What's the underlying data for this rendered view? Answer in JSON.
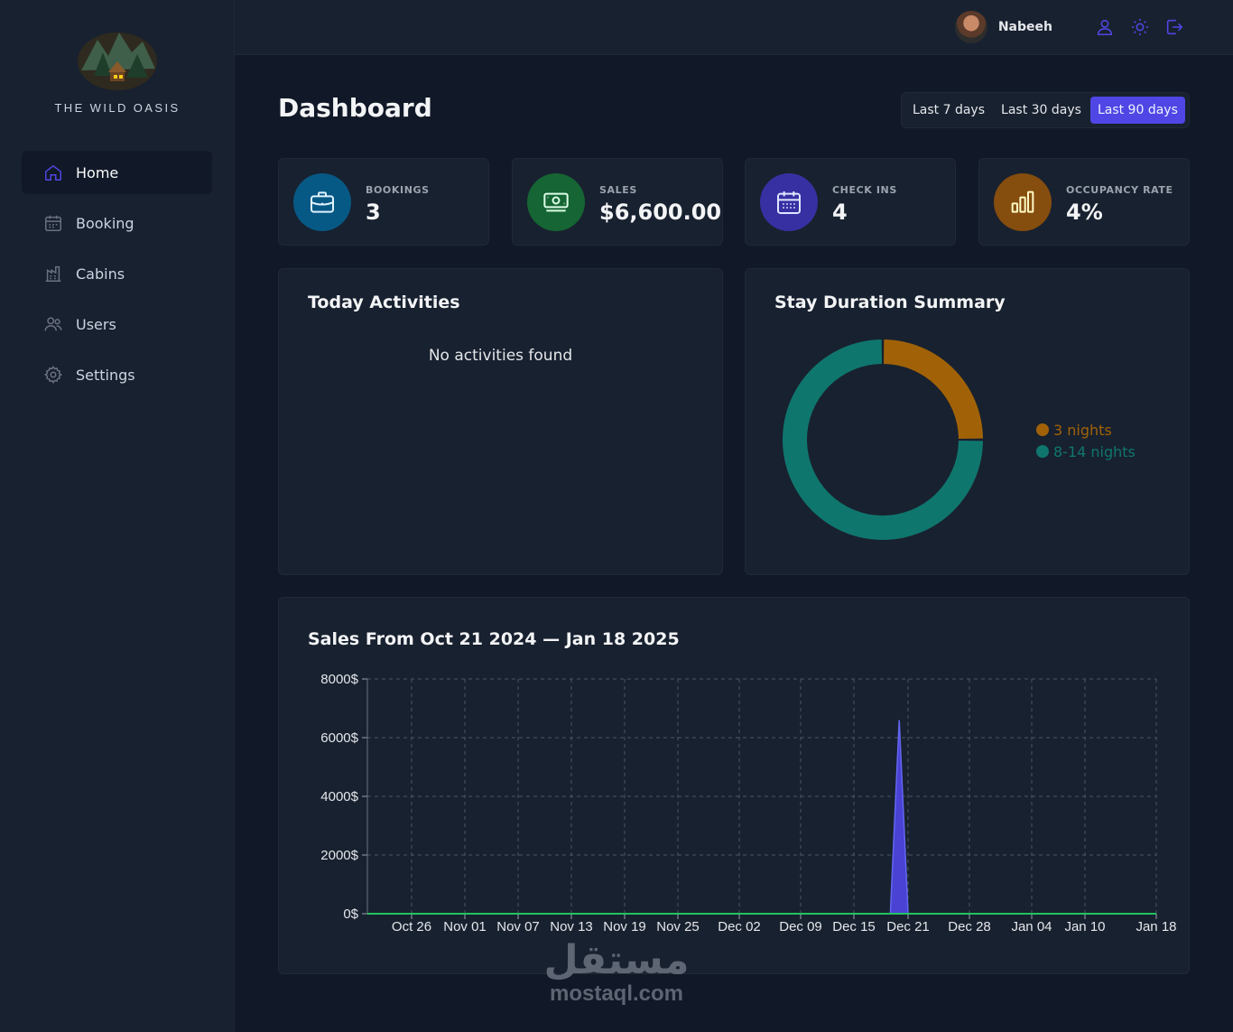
{
  "brand": {
    "name": "THE WILD OASIS"
  },
  "sidebar": {
    "items": [
      {
        "label": "Home",
        "icon": "home-icon",
        "active": true
      },
      {
        "label": "Booking",
        "icon": "calendar-icon",
        "active": false
      },
      {
        "label": "Cabins",
        "icon": "cabins-icon",
        "active": false
      },
      {
        "label": "Users",
        "icon": "users-icon",
        "active": false
      },
      {
        "label": "Settings",
        "icon": "gear-icon",
        "active": false
      }
    ]
  },
  "header": {
    "user_name": "Nabeeh",
    "buttons": [
      "user-icon",
      "sun-icon",
      "logout-icon"
    ]
  },
  "page": {
    "title": "Dashboard"
  },
  "filter": {
    "options": [
      "Last 7 days",
      "Last 30 days",
      "Last 90 days"
    ],
    "selected": "Last 90 days"
  },
  "stats": [
    {
      "label": "BOOKINGS",
      "value": "3",
      "icon": "briefcase-icon",
      "color": "#075985",
      "icon_color": "#e0f2fe"
    },
    {
      "label": "SALES",
      "value": "$6,600.00",
      "icon": "banknotes-icon",
      "color": "#166534",
      "icon_color": "#dcfce7"
    },
    {
      "label": "CHECK INS",
      "value": "4",
      "icon": "calendar-days-icon",
      "color": "#3730a3",
      "icon_color": "#e0e7ff"
    },
    {
      "label": "OCCUPANCY RATE",
      "value": "4%",
      "icon": "chart-bar-icon",
      "color": "#854d0e",
      "icon_color": "#fef9c3"
    }
  ],
  "activities": {
    "title": "Today Activities",
    "empty_message": "No activities found"
  },
  "duration": {
    "title": "Stay Duration Summary"
  },
  "sales": {
    "title": "Sales From Oct 21 2024 — Jan 18 2025"
  },
  "colors": {
    "accent": "#4f46e5",
    "orange": "#a16207",
    "teal": "#0f766e",
    "green_line": "#22c55e",
    "area": "#4f46e5"
  },
  "watermark": {
    "arabic": "مستقل",
    "latin": "mostaql.com"
  },
  "chart_data": [
    {
      "type": "pie",
      "labels": [
        "3 nights",
        "8-14 nights"
      ],
      "values": [
        1,
        3
      ],
      "colors": [
        "#a16207",
        "#0f766e"
      ],
      "legend": "right"
    },
    {
      "type": "area",
      "xlabel": "",
      "ylabel": "",
      "x_tick_labels": [
        "Oct 26",
        "Nov 01",
        "Nov 07",
        "Nov 13",
        "Nov 19",
        "Nov 25",
        "Dec 02",
        "Dec 09",
        "Dec 15",
        "Dec 21",
        "Dec 28",
        "Jan 04",
        "Jan 10",
        "Jan 18"
      ],
      "y_tick_labels": [
        "0$",
        "2000$",
        "4000$",
        "6000$",
        "8000$"
      ],
      "ylim": [
        0,
        8000
      ],
      "grid": true,
      "series": [
        {
          "x": [
            "Dec 18",
            "Dec 19",
            "Dec 20",
            "Dec 21",
            "Dec 22"
          ],
          "y": [
            0,
            0,
            6600,
            0,
            0
          ]
        }
      ]
    }
  ]
}
